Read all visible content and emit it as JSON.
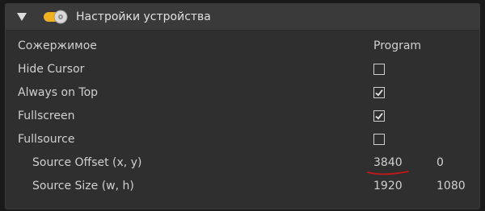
{
  "header": {
    "title": "Настройки устройства",
    "collapse_icon": "triangle-down-icon",
    "device_icon": "toggle-disc-icon"
  },
  "columns": {
    "left": "Сожержимое",
    "right": "Program"
  },
  "options": [
    {
      "label": "Hide Cursor",
      "checked": false
    },
    {
      "label": "Always on Top",
      "checked": true
    },
    {
      "label": "Fullscreen",
      "checked": true
    },
    {
      "label": "Fullsource",
      "checked": false
    }
  ],
  "source_offset": {
    "label": "Source Offset (x, y)",
    "x": "3840",
    "y": "0"
  },
  "source_size": {
    "label": "Source Size (w, h)",
    "w": "1920",
    "h": "1080"
  },
  "colors": {
    "panel": "#2f2f2f",
    "header": "#3a3a3a",
    "annotation": "#c41818",
    "toggle": "#f0b020"
  }
}
